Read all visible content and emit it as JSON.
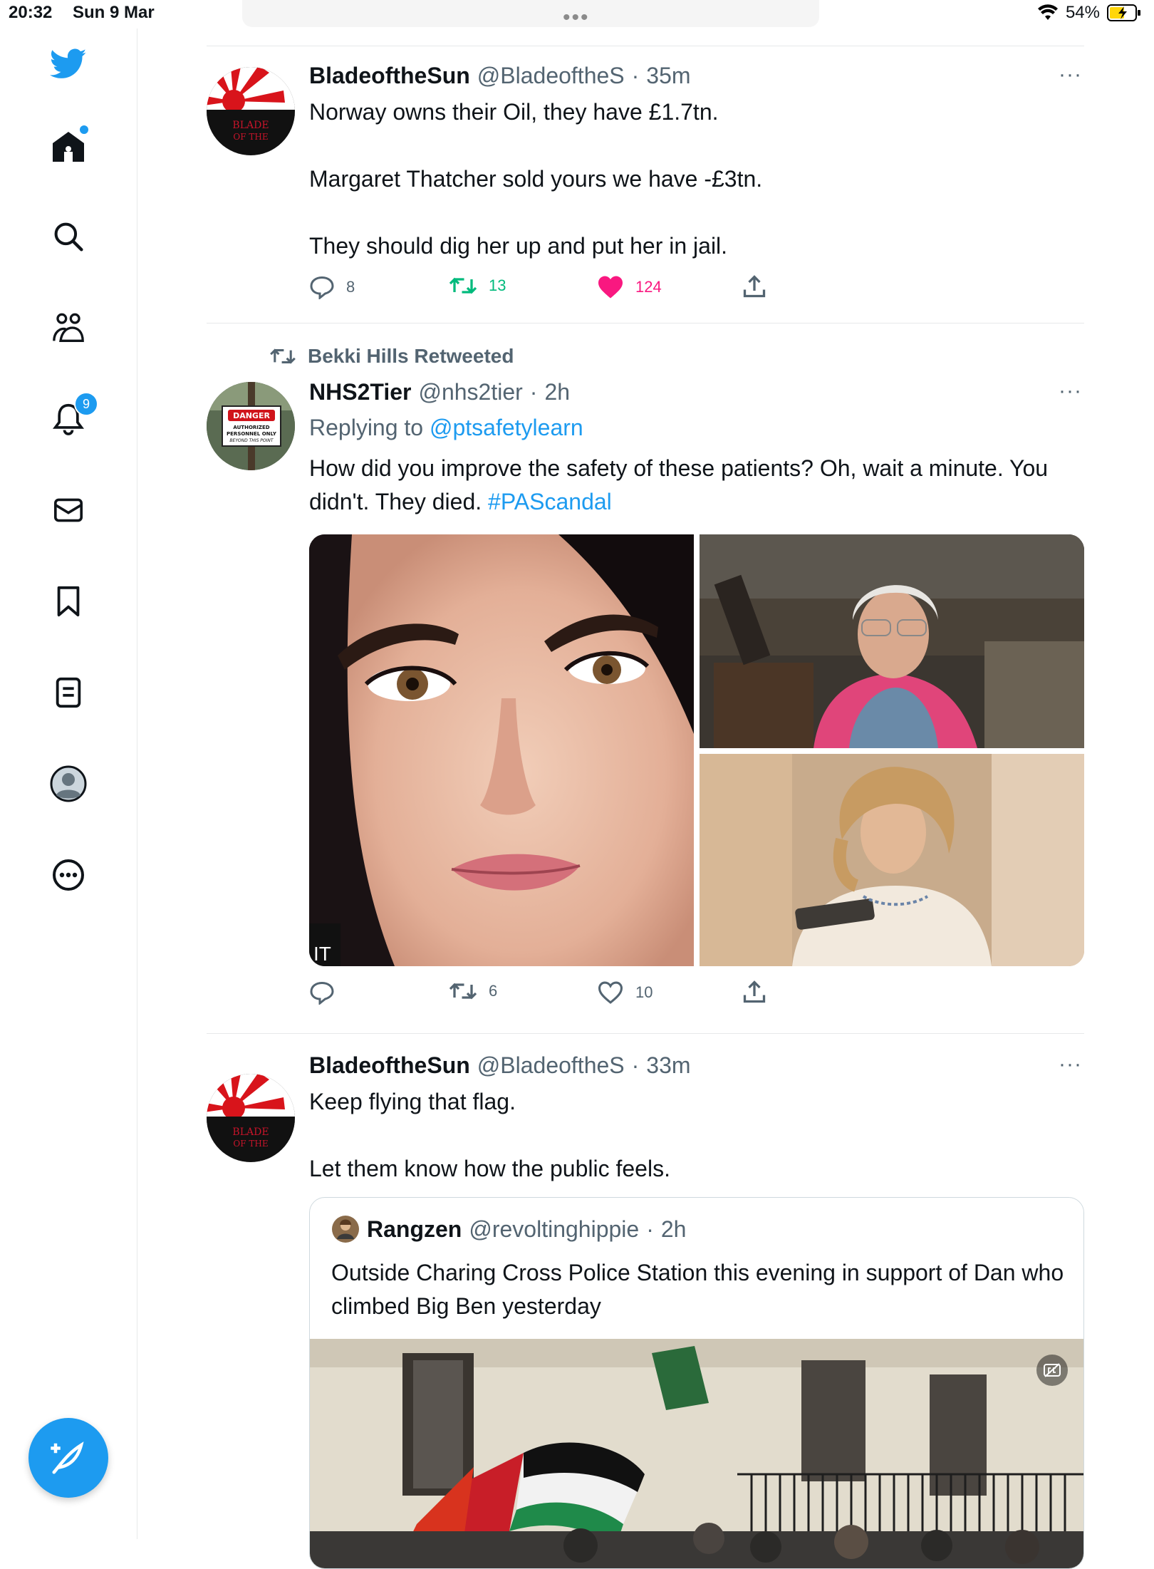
{
  "status_bar": {
    "time": "20:32",
    "date": "Sun 9 Mar",
    "battery": "54%"
  },
  "sidebar": {
    "notifications_badge": "9"
  },
  "tweets": [
    {
      "name": "BladeoftheSun",
      "handle": "@BladeoftheS",
      "time": "35m",
      "text": "Norway owns their Oil, they have £1.7tn.\n\nMargaret Thatcher sold yours we have -£3tn.\n\nThey should dig her up and put her in jail.",
      "replies": "8",
      "retweets": "13",
      "likes": "124"
    },
    {
      "retweeted_by": "Bekki Hills Retweeted",
      "name": "NHS2Tier",
      "handle": "@nhs2tier",
      "time": "2h",
      "replying_prefix": "Replying to",
      "replying_to": "@ptsafetylearn",
      "text": "How did you improve the safety of these patients? Oh, wait a minute. You didn't. They died.",
      "hashtag": "#PAScandal",
      "media_caption": "IT",
      "retweets": "6",
      "likes": "10"
    },
    {
      "name": "BladeoftheSun",
      "handle": "@BladeoftheS",
      "time": "33m",
      "text": "Keep flying that flag.\n\nLet them know how the public feels.",
      "quote": {
        "name": "Rangzen",
        "handle": "@revoltinghippie",
        "time": "2h",
        "text": "Outside Charing Cross Police Station this evening in support of Dan who climbed Big Ben yesterday"
      }
    }
  ],
  "avatar_text": {
    "blade_line1": "BLADE",
    "blade_line2": "OF THE",
    "danger": "DANGER",
    "danger_sub1": "AUTHORIZED",
    "danger_sub2": "PERSONNEL ONLY",
    "danger_sub3": "BEYOND THIS POINT"
  },
  "colors": {
    "accent": "#1d9bf0",
    "retweet": "#00ba7c",
    "like": "#f91880"
  }
}
